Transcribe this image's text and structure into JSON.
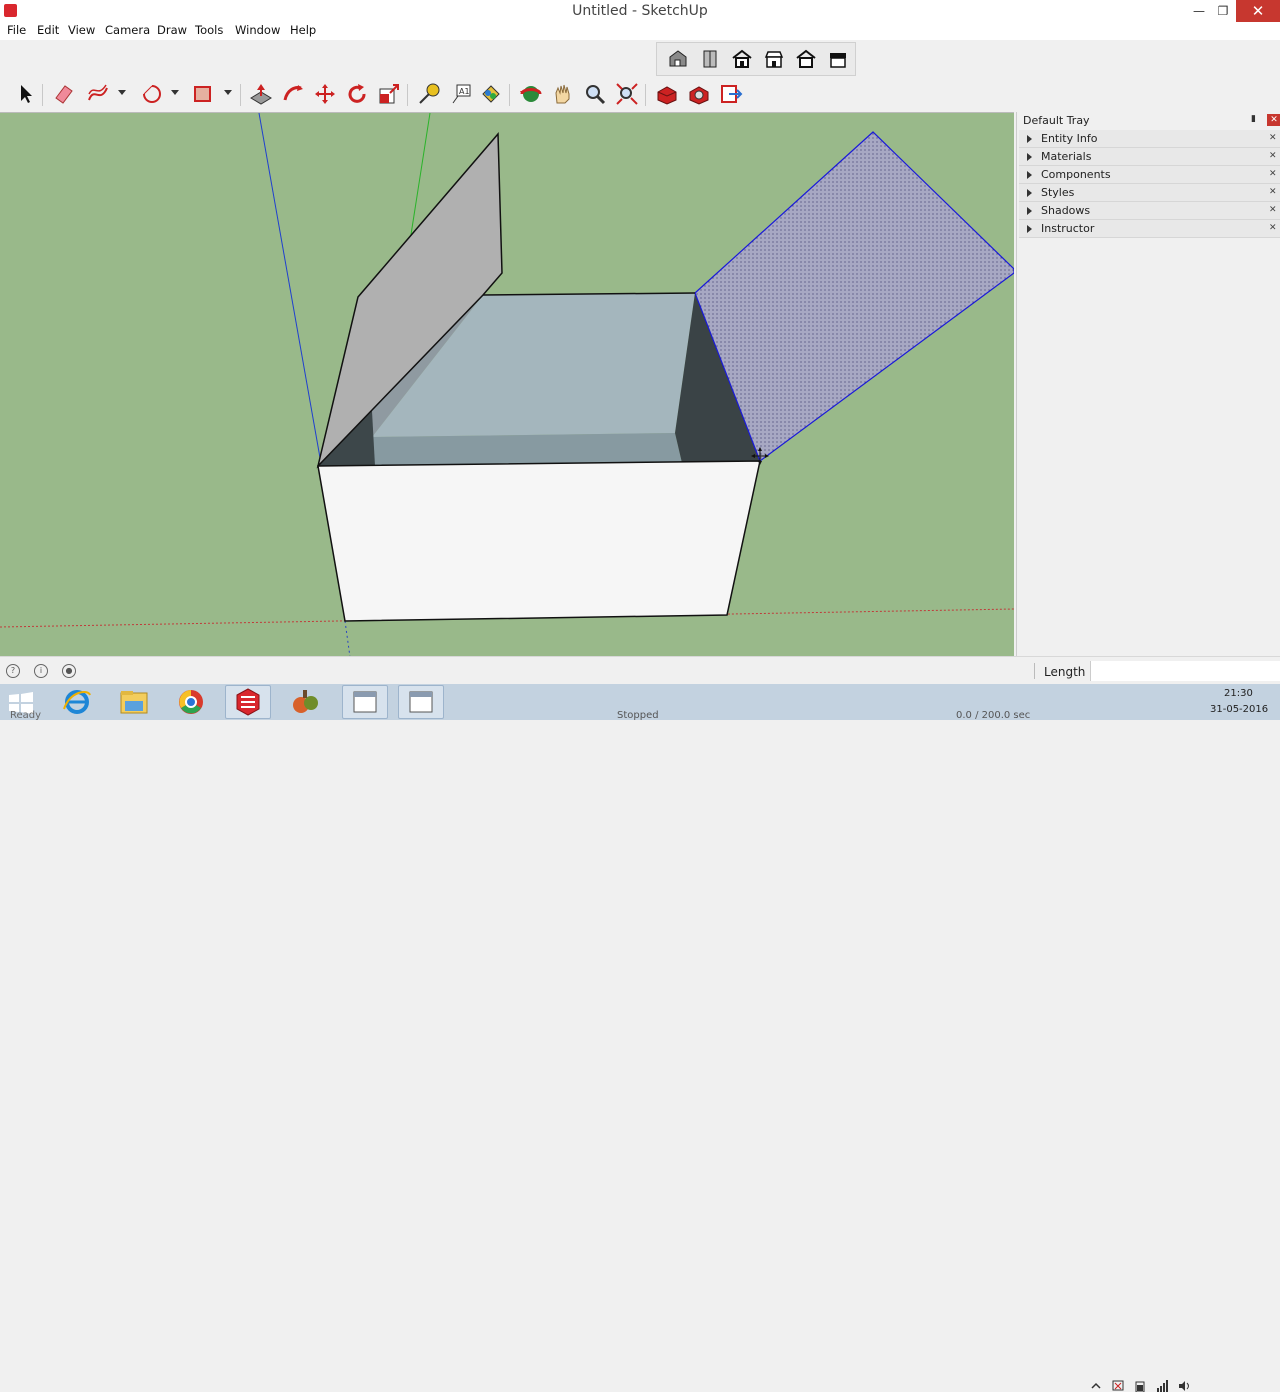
{
  "window": {
    "title": "Untitled - SketchUp"
  },
  "menu": {
    "items": [
      "File",
      "Edit",
      "View",
      "Camera",
      "Draw",
      "Tools",
      "Window",
      "Help"
    ]
  },
  "views_toolbar": {
    "icons": [
      "iso-view-icon",
      "top-view-icon",
      "front-view-icon",
      "right-view-icon",
      "back-view-icon",
      "left-view-icon"
    ]
  },
  "main_toolbar": {
    "icons": [
      "select-icon",
      "eraser-icon",
      "freehand-icon",
      "arc-icon",
      "rectangle-icon",
      "push-pull-icon",
      "follow-me-icon",
      "move-icon",
      "rotate-icon",
      "scale-icon",
      "tape-measure-icon",
      "text-icon",
      "paint-bucket-icon",
      "orbit-icon",
      "pan-icon",
      "zoom-icon",
      "zoom-extents-icon",
      "warehouse-icon",
      "extension-warehouse-icon",
      "send-to-layout-icon"
    ],
    "active_tool": "move-icon"
  },
  "tray": {
    "title": "Default Tray",
    "panels": [
      "Entity Info",
      "Materials",
      "Components",
      "Styles",
      "Shadows",
      "Instructor"
    ]
  },
  "statusbar": {
    "measurement_label": "Length",
    "measurement_value": ""
  },
  "taskbar": {
    "apps": [
      "windows-start-icon",
      "internet-explorer-icon",
      "file-explorer-icon",
      "chrome-icon",
      "sketchup-icon",
      "app-icon",
      "window-icon",
      "window-icon"
    ],
    "status_ready": "Ready",
    "status_stopped": "Stopped",
    "status_time": "0.0 / 200.0 sec",
    "clock_time": "21:30",
    "clock_date": "31-05-2016"
  },
  "colors": {
    "viewport_bg": "#99b98a",
    "selection_blue": "#0000ff",
    "close_button": "#c7372f"
  }
}
